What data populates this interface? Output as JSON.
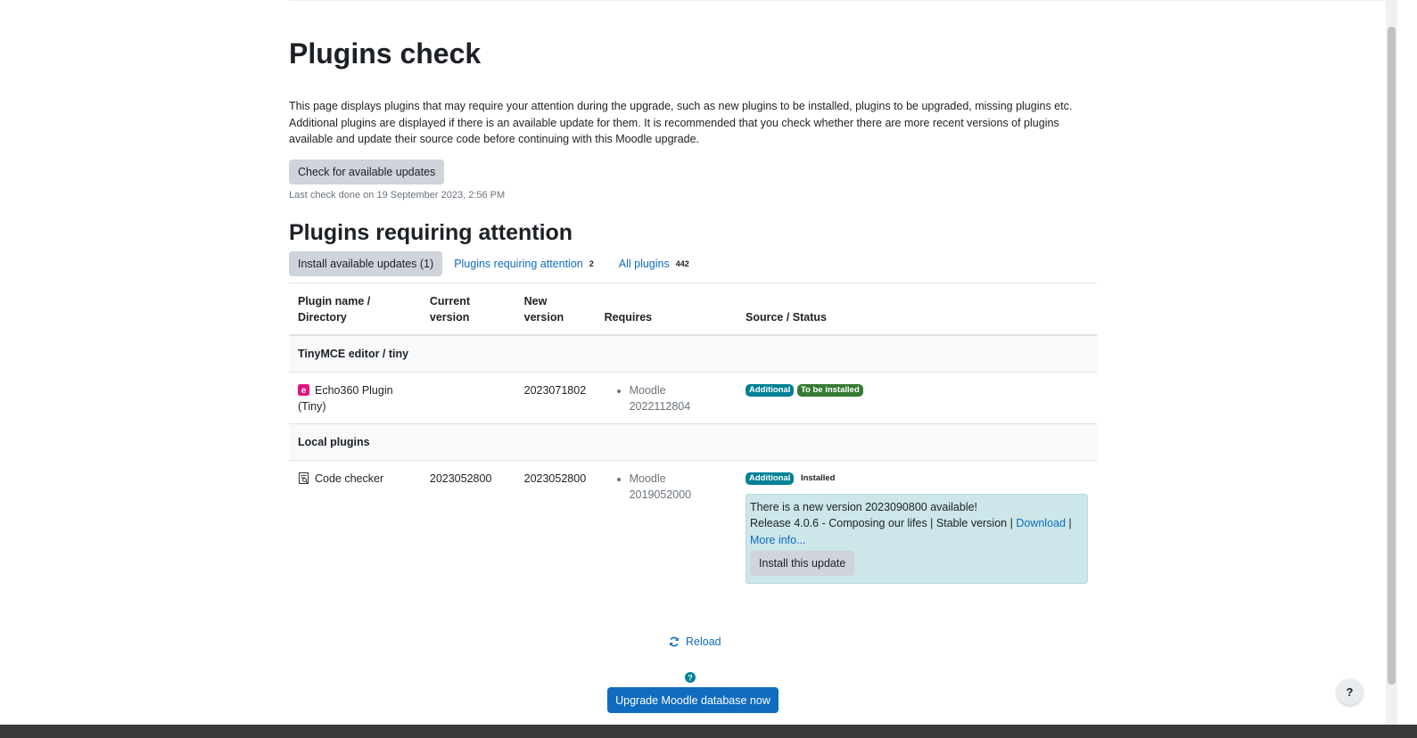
{
  "page": {
    "title": "Plugins check",
    "intro": "This page displays plugins that may require your attention during the upgrade, such as new plugins to be installed, plugins to be upgraded, missing plugins etc. Additional plugins are displayed if there is an available update for them. It is recommended that you check whether there are more recent versions of plugins available and update their source code before continuing with this Moodle upgrade.",
    "check_button": "Check for available updates",
    "last_check": "Last check done on 19 September 2023, 2:56 PM"
  },
  "attention": {
    "heading": "Plugins requiring attention",
    "install_button": "Install available updates (1)",
    "tabs": [
      {
        "label": "Plugins requiring attention",
        "count": "2"
      },
      {
        "label": "All plugins",
        "count": "442"
      }
    ]
  },
  "table": {
    "headers": {
      "name": "Plugin name / Directory",
      "current": "Current version",
      "new": "New version",
      "requires": "Requires",
      "source": "Source / Status"
    },
    "groups": [
      {
        "label": "TinyMCE editor / tiny",
        "plugin": {
          "name": "Echo360 Plugin (Tiny)",
          "icon": "echo360-icon",
          "current": "",
          "new": "2023071802",
          "requires": "Moodle 2022112804",
          "badge_source": "Additional",
          "badge_status": "To be installed"
        }
      },
      {
        "label": "Local plugins",
        "plugin": {
          "name": "Code checker",
          "icon": "code-checker-icon",
          "current": "2023052800",
          "new": "2023052800",
          "requires": "Moodle 2019052000",
          "badge_source": "Additional",
          "badge_status": "Installed",
          "update": {
            "line1": "There is a new version 2023090800 available!",
            "line2": "Release 4.0.6 - Composing our lifes | Stable version |",
            "download": "Download",
            "sep": "|",
            "more": "More info...",
            "install_button": "Install this update"
          }
        }
      }
    ]
  },
  "footer": {
    "reload": "Reload",
    "upgrade_button": "Upgrade Moodle database now",
    "help_glyph": "?"
  },
  "colors": {
    "link": "#0f6cbf",
    "badge_info": "#008196",
    "badge_success": "#357a32",
    "update_box": "#cce6ea"
  }
}
